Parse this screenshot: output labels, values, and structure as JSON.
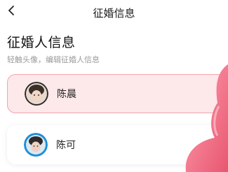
{
  "header": {
    "title": "征婚信息",
    "back_icon": "chevron-left-icon"
  },
  "section": {
    "title": "征婚人信息",
    "hint": "轻触头像，编辑征婚人信息"
  },
  "profiles": [
    {
      "name": "陈晨",
      "selected": true,
      "avatar": "avatar-photo"
    },
    {
      "name": "陈可",
      "selected": false,
      "avatar": "avatar-photo"
    }
  ],
  "colors": {
    "selected_bg": "#fde8ea",
    "selected_border": "#f5a3ab",
    "hint_text": "#9a9a9a",
    "decoration_pink": "#f27a92"
  }
}
